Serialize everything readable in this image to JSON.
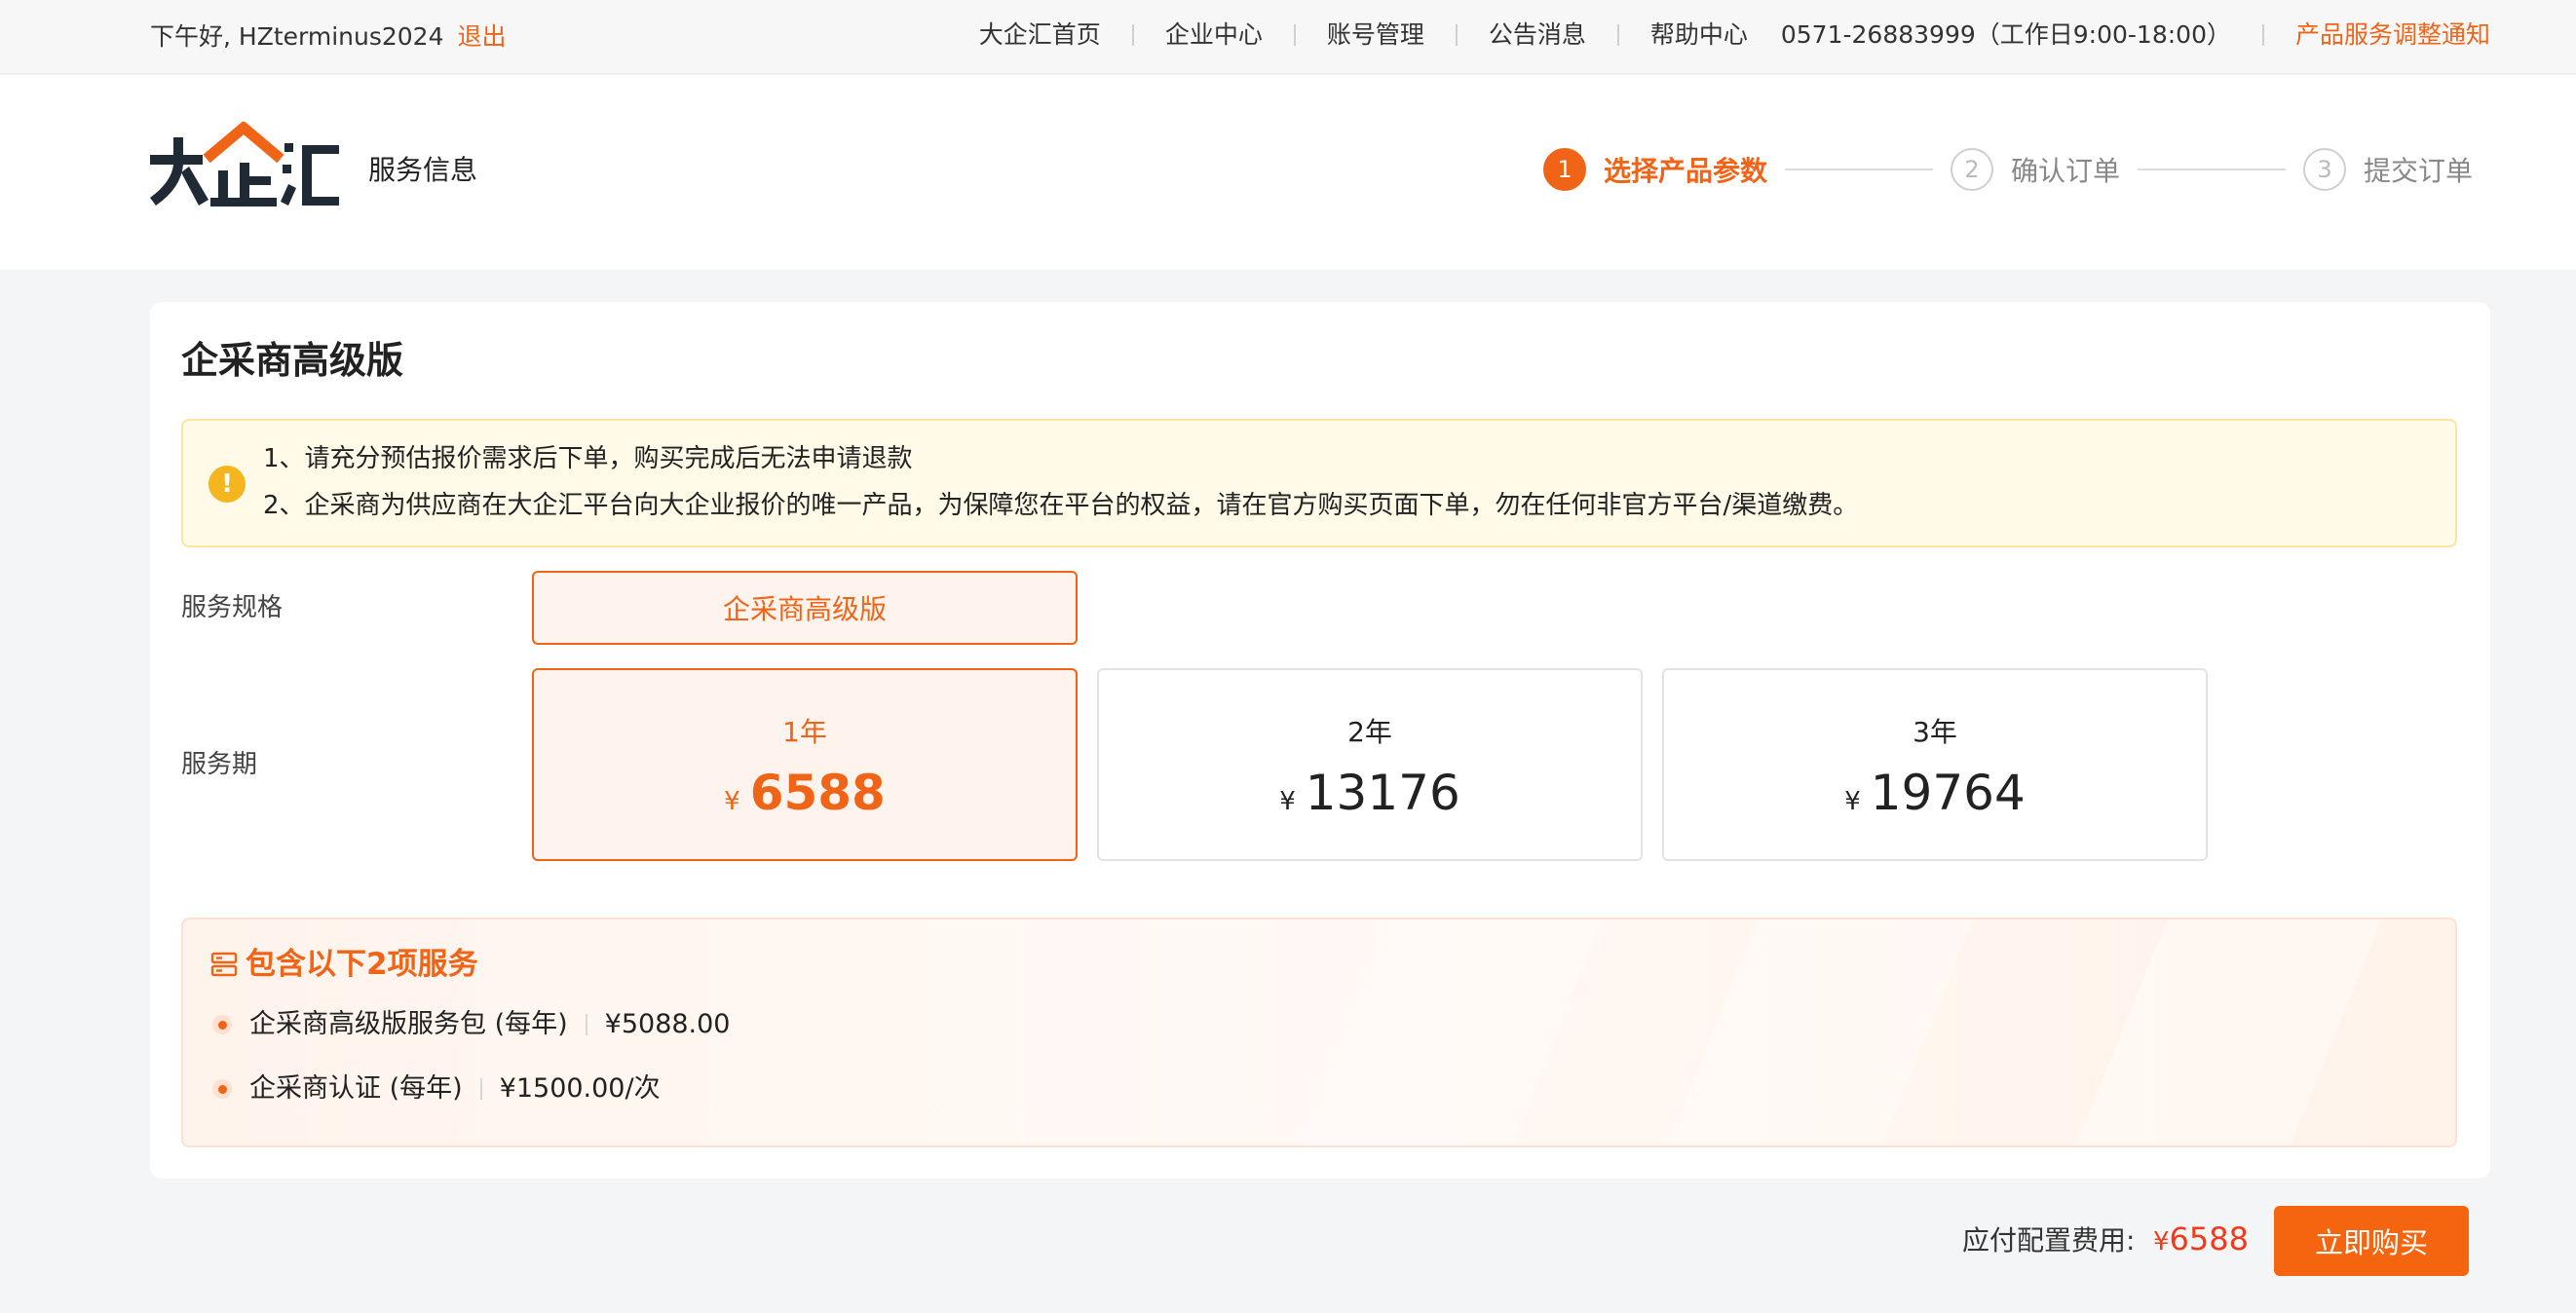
{
  "topbar": {
    "greeting": "下午好, HZterminus2024",
    "logout": "退出",
    "nav": [
      "大企汇首页",
      "企业中心",
      "账号管理",
      "公告消息",
      "帮助中心"
    ],
    "phone": "0571-26883999（工作日9:00-18:00）",
    "notice_link": "产品服务调整通知"
  },
  "header": {
    "logo_text": "大企汇",
    "subtitle": "服务信息",
    "steps": [
      {
        "num": "1",
        "label": "选择产品参数"
      },
      {
        "num": "2",
        "label": "确认订单"
      },
      {
        "num": "3",
        "label": "提交订单"
      }
    ]
  },
  "product": {
    "title": "企采商高级版",
    "notices": [
      "1、请充分预估报价需求后下单，购买完成后无法申请退款",
      "2、企采商为供应商在大企汇平台向大企业报价的唯一产品，为保障您在平台的权益，请在官方购买页面下单，勿在任何非官方平台/渠道缴费。"
    ],
    "spec_label": "服务规格",
    "spec_value": "企采商高级版",
    "period_label": "服务期",
    "periods": [
      {
        "year": "1年",
        "currency": "¥",
        "price": "6588"
      },
      {
        "year": "2年",
        "currency": "¥",
        "price": "13176"
      },
      {
        "year": "3年",
        "currency": "¥",
        "price": "19764"
      }
    ],
    "includes_title": "包含以下2项服务",
    "services": [
      {
        "name": "企采商高级版服务包 (每年)",
        "price": "¥5088.00"
      },
      {
        "name": "企采商认证 (每年)",
        "price": "¥1500.00/次"
      }
    ]
  },
  "footer": {
    "label": "应付配置费用:",
    "currency": "¥",
    "amount": "6588",
    "buy_label": "立即购买"
  },
  "colors": {
    "accent": "#f06418",
    "price_red": "#f03a1a",
    "notice_bg": "#fffbe8",
    "notice_icon": "#f5b51e"
  }
}
